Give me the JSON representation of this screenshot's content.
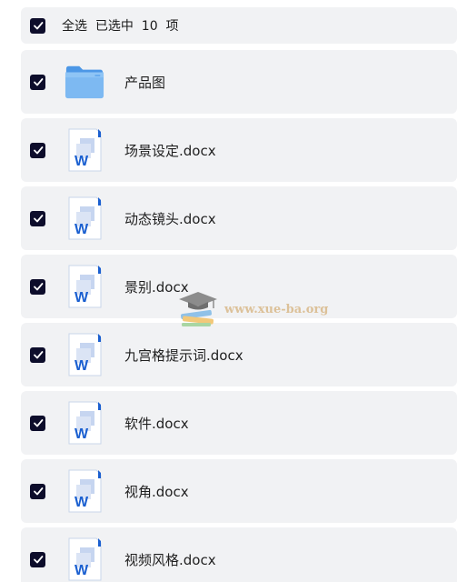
{
  "select_all": {
    "label": "全选  已选中  10  项",
    "checked": true
  },
  "files": [
    {
      "name": "产品图",
      "type": "folder",
      "checked": true
    },
    {
      "name": "场景设定.docx",
      "type": "word-doc",
      "checked": true
    },
    {
      "name": "动态镜头.docx",
      "type": "word-doc",
      "checked": true
    },
    {
      "name": "景别.docx",
      "type": "word-doc",
      "checked": true
    },
    {
      "name": "九宫格提示词.docx",
      "type": "word-doc",
      "checked": true
    },
    {
      "name": "软件.docx",
      "type": "word-doc",
      "checked": true
    },
    {
      "name": "视角.docx",
      "type": "word-doc",
      "checked": true
    },
    {
      "name": "视频风格.docx",
      "type": "word-doc",
      "checked": true
    }
  ],
  "watermark": {
    "text": "www.xue-ba.org",
    "icon": "graduation-cap-books-icon"
  },
  "colors": {
    "row_background": "#f1f2f4",
    "checkbox": "#0d0d2b",
    "folder": "#6fb1ef",
    "word_blue": "#1a5fd0",
    "watermark": "#d9b98a"
  }
}
